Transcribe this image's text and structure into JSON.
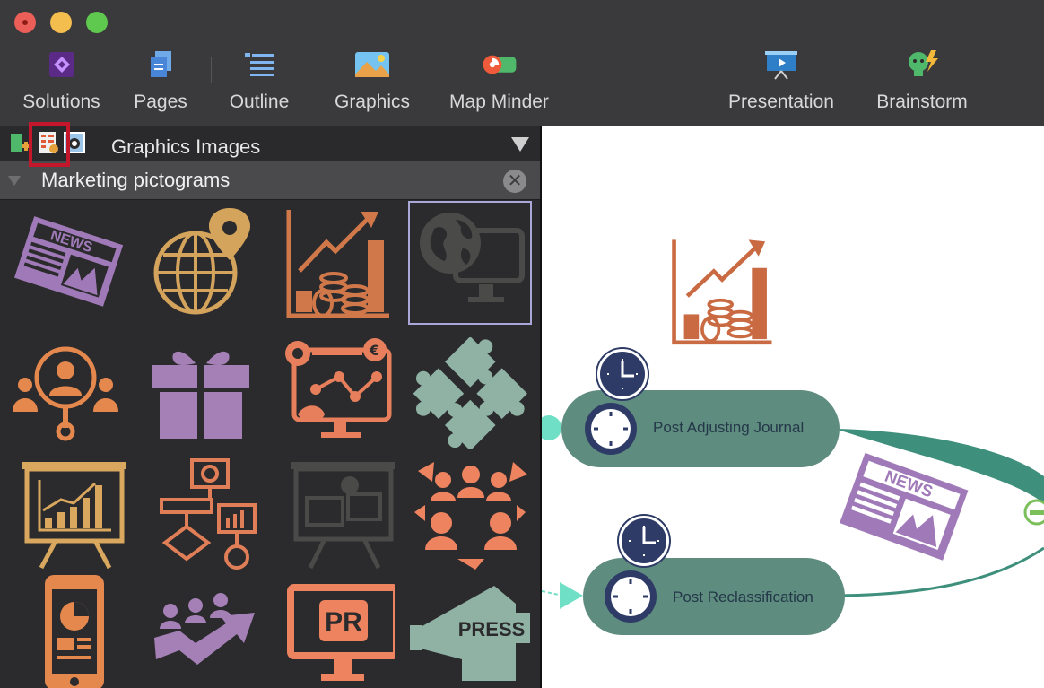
{
  "window": {
    "traffic_lights": [
      "close",
      "minimize",
      "maximize"
    ]
  },
  "toolbar": {
    "items": [
      {
        "label": "Solutions",
        "icon": "solutions-icon"
      },
      {
        "label": "Pages",
        "icon": "pages-icon"
      },
      {
        "label": "Outline",
        "icon": "outline-icon"
      },
      {
        "label": "Graphics",
        "icon": "graphics-icon"
      },
      {
        "label": "Map Minder",
        "icon": "map-minder-icon"
      },
      {
        "label": "Presentation",
        "icon": "presentation-icon"
      },
      {
        "label": "Brainstorm",
        "icon": "brainstorm-icon"
      }
    ]
  },
  "panel": {
    "title": "Graphics Images",
    "library": {
      "title": "Marketing pictograms",
      "close_glyph": "✕"
    },
    "pictograms": [
      {
        "name": "news-icon",
        "color": "#a07ab8"
      },
      {
        "name": "globe-location-icon",
        "color": "#d4a35c"
      },
      {
        "name": "growth-chart-icon",
        "color": "#d0784a"
      },
      {
        "name": "globe-monitor-icon",
        "color": "#4a4a48",
        "selected": true
      },
      {
        "name": "target-audience-icon",
        "color": "#e5884e"
      },
      {
        "name": "gift-icon",
        "color": "#a580b6"
      },
      {
        "name": "digital-marketing-icon",
        "color": "#e87f5c"
      },
      {
        "name": "puzzle-icon",
        "color": "#8fb2a5"
      },
      {
        "name": "presentation-board-icon",
        "color": "#d9a85e"
      },
      {
        "name": "flowchart-icon",
        "color": "#e07e57"
      },
      {
        "name": "media-board-icon",
        "color": "#4a4a48"
      },
      {
        "name": "team-cycle-icon",
        "color": "#ee8360"
      },
      {
        "name": "mobile-analytics-icon",
        "color": "#e5884e"
      },
      {
        "name": "team-growth-icon",
        "color": "#a580b6"
      },
      {
        "name": "pr-monitor-icon",
        "color": "#ee8360",
        "text": "PR"
      },
      {
        "name": "press-megaphone-icon",
        "color": "#8fb2a5",
        "text": "PRESS"
      }
    ]
  },
  "canvas": {
    "nodes": [
      {
        "label": "Post Adjusting Journal"
      },
      {
        "label": "Post Reclassification"
      }
    ],
    "colors": {
      "node": "#5e8c7e",
      "clock": "#2e3b66",
      "connector": "#3e8f7c",
      "accent": "#6fe0c6"
    }
  }
}
